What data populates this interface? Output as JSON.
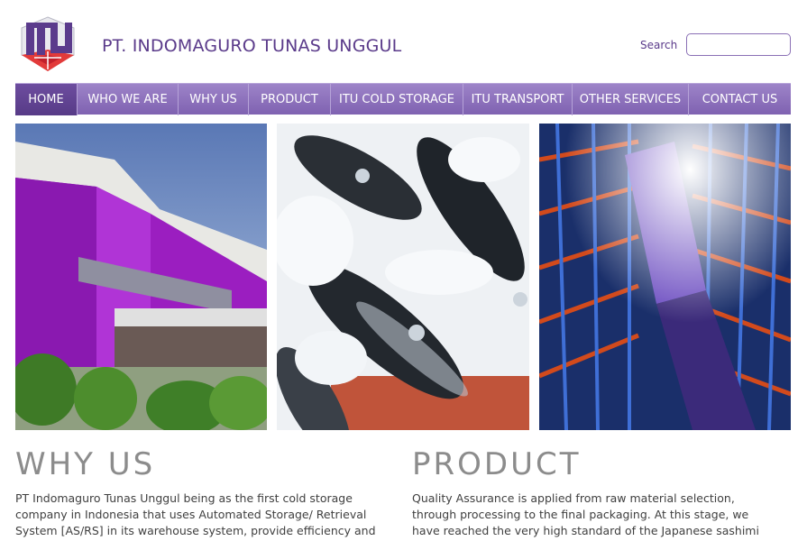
{
  "header": {
    "company_name": "PT. INDOMAGURO TUNAS UNGGUL",
    "logo_icon": "itu-logo-icon",
    "search_label": "Search",
    "search_value": ""
  },
  "nav": {
    "items": [
      {
        "label": "HOME",
        "active": true
      },
      {
        "label": "WHO WE ARE"
      },
      {
        "label": "WHY US"
      },
      {
        "label": "PRODUCT"
      },
      {
        "label": "ITU COLD STORAGE"
      },
      {
        "label": "ITU TRANSPORT"
      },
      {
        "label": "OTHER SERVICES"
      },
      {
        "label": "CONTACT US"
      }
    ]
  },
  "sections": {
    "why_us": {
      "title": "WHY US",
      "text": "PT Indomaguro Tunas Unggul being as the first cold storage company in Indonesia that uses Automated Storage/ Retrieval System [AS/RS] in its warehouse system, provide efficiency and"
    },
    "product": {
      "title": "PRODUCT",
      "text": "Quality Assurance is applied from raw material selection, through processing to the final packaging. At this stage, we have reached the very high standard of the Japanese sashimi sanitation"
    }
  },
  "colors": {
    "brand_purple": "#5a3a8a",
    "nav_bg": "#8a6fbb",
    "nav_active": "#62458f",
    "heading_gray": "#8c8c8c"
  }
}
